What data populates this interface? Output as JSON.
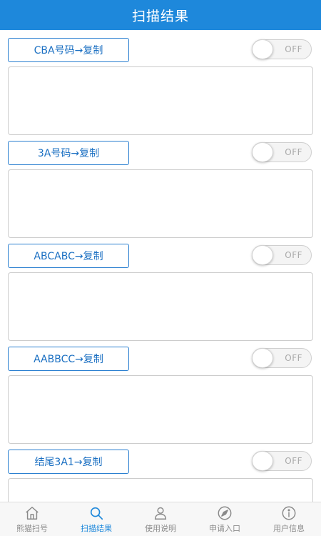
{
  "header": {
    "title": "扫描结果"
  },
  "sections": [
    {
      "button_label": "CBA号码→复制",
      "toggle_label": "OFF",
      "result_text": ""
    },
    {
      "button_label": "3A号码→复制",
      "toggle_label": "OFF",
      "result_text": ""
    },
    {
      "button_label": "ABCABC→复制",
      "toggle_label": "OFF",
      "result_text": ""
    },
    {
      "button_label": "AABBCC→复制",
      "toggle_label": "OFF",
      "result_text": ""
    },
    {
      "button_label": "结尾3A1→复制",
      "toggle_label": "OFF",
      "result_text": ""
    }
  ],
  "tabbar": {
    "tabs": [
      {
        "label": "熊猫扫号",
        "icon": "home-icon"
      },
      {
        "label": "扫描结果",
        "icon": "search-icon"
      },
      {
        "label": "使用说明",
        "icon": "user-icon"
      },
      {
        "label": "申请入口",
        "icon": "navigation-icon"
      },
      {
        "label": "用户信息",
        "icon": "info-icon"
      }
    ],
    "active_index": 1
  },
  "colors": {
    "primary": "#1e88db",
    "button_border": "#2a7fd0",
    "inactive_tab": "#8a8a8a"
  }
}
